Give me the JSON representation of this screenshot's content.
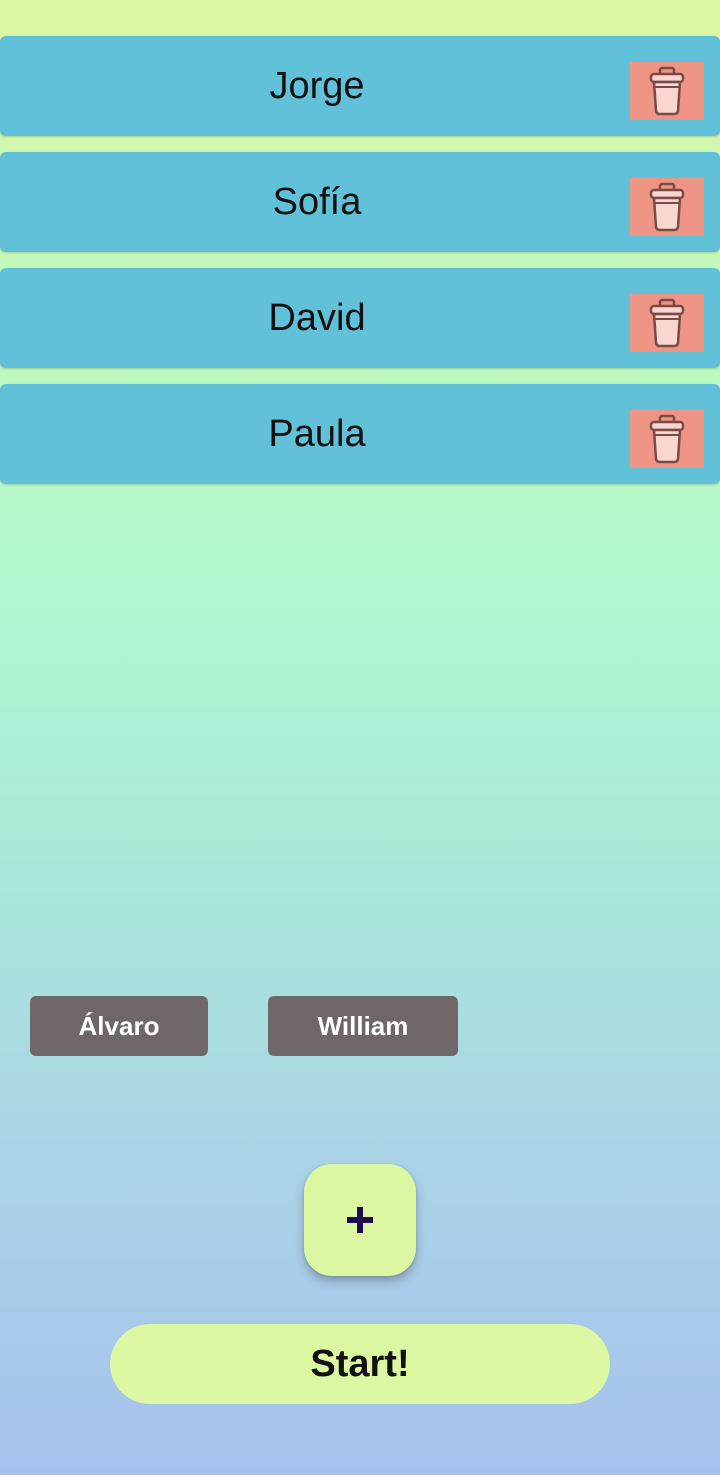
{
  "players": [
    {
      "name": "Jorge"
    },
    {
      "name": "Sofía"
    },
    {
      "name": "David"
    },
    {
      "name": "Paula"
    }
  ],
  "delete_icon": "trash-icon",
  "suggestions": [
    "Álvaro",
    "William"
  ],
  "add_button": {
    "icon": "plus-icon",
    "symbol": "+"
  },
  "start_button": {
    "label": "Start!"
  },
  "colors": {
    "row_background": "#60c1d8",
    "delete_background": "#ef9585",
    "trash_icon_stroke": "#7a4a46",
    "trash_icon_fill": "#f9d6cf",
    "chip_background": "#6f6767",
    "accent_light_green": "#dcf7a2",
    "plus_color": "#1e0a50"
  }
}
